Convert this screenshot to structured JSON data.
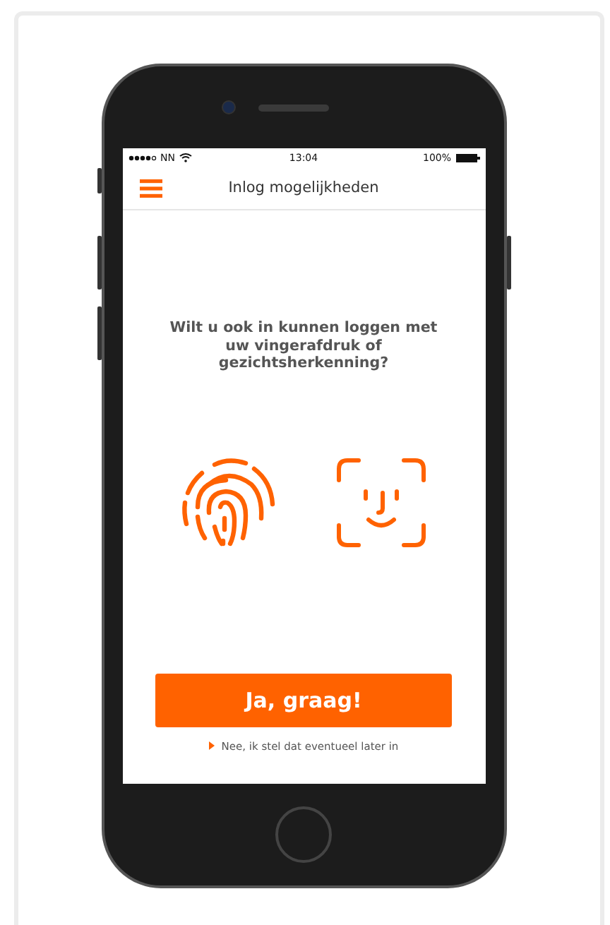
{
  "status_bar": {
    "carrier": "NN",
    "time": "13:04",
    "battery": "100%"
  },
  "nav_bar": {
    "title": "Inlog mogelijkheden"
  },
  "prompt": "Wilt u ook in kunnen loggen met uw vingerafdruk of gezichtsherkenning?",
  "primary_button": "Ja, graag!",
  "secondary_link": "Nee, ik stel dat eventueel later in"
}
